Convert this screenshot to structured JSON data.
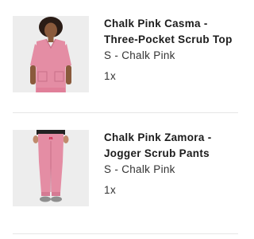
{
  "cart": {
    "items": [
      {
        "title_line1": "Chalk Pink Casma -",
        "title_line2": "Three-Pocket Scrub Top",
        "variant": "S - Chalk Pink",
        "quantity": "1x",
        "image_icon": "scrub-top-model-image"
      },
      {
        "title_line1": "Chalk Pink Zamora -",
        "title_line2": "Jogger Scrub Pants",
        "variant": "S - Chalk Pink",
        "quantity": "1x",
        "image_icon": "jogger-pants-model-image"
      }
    ]
  },
  "colors": {
    "product_pink": "#e48da4",
    "image_background": "#ededed",
    "title_text": "#1c1c1c",
    "body_text": "#333333"
  }
}
